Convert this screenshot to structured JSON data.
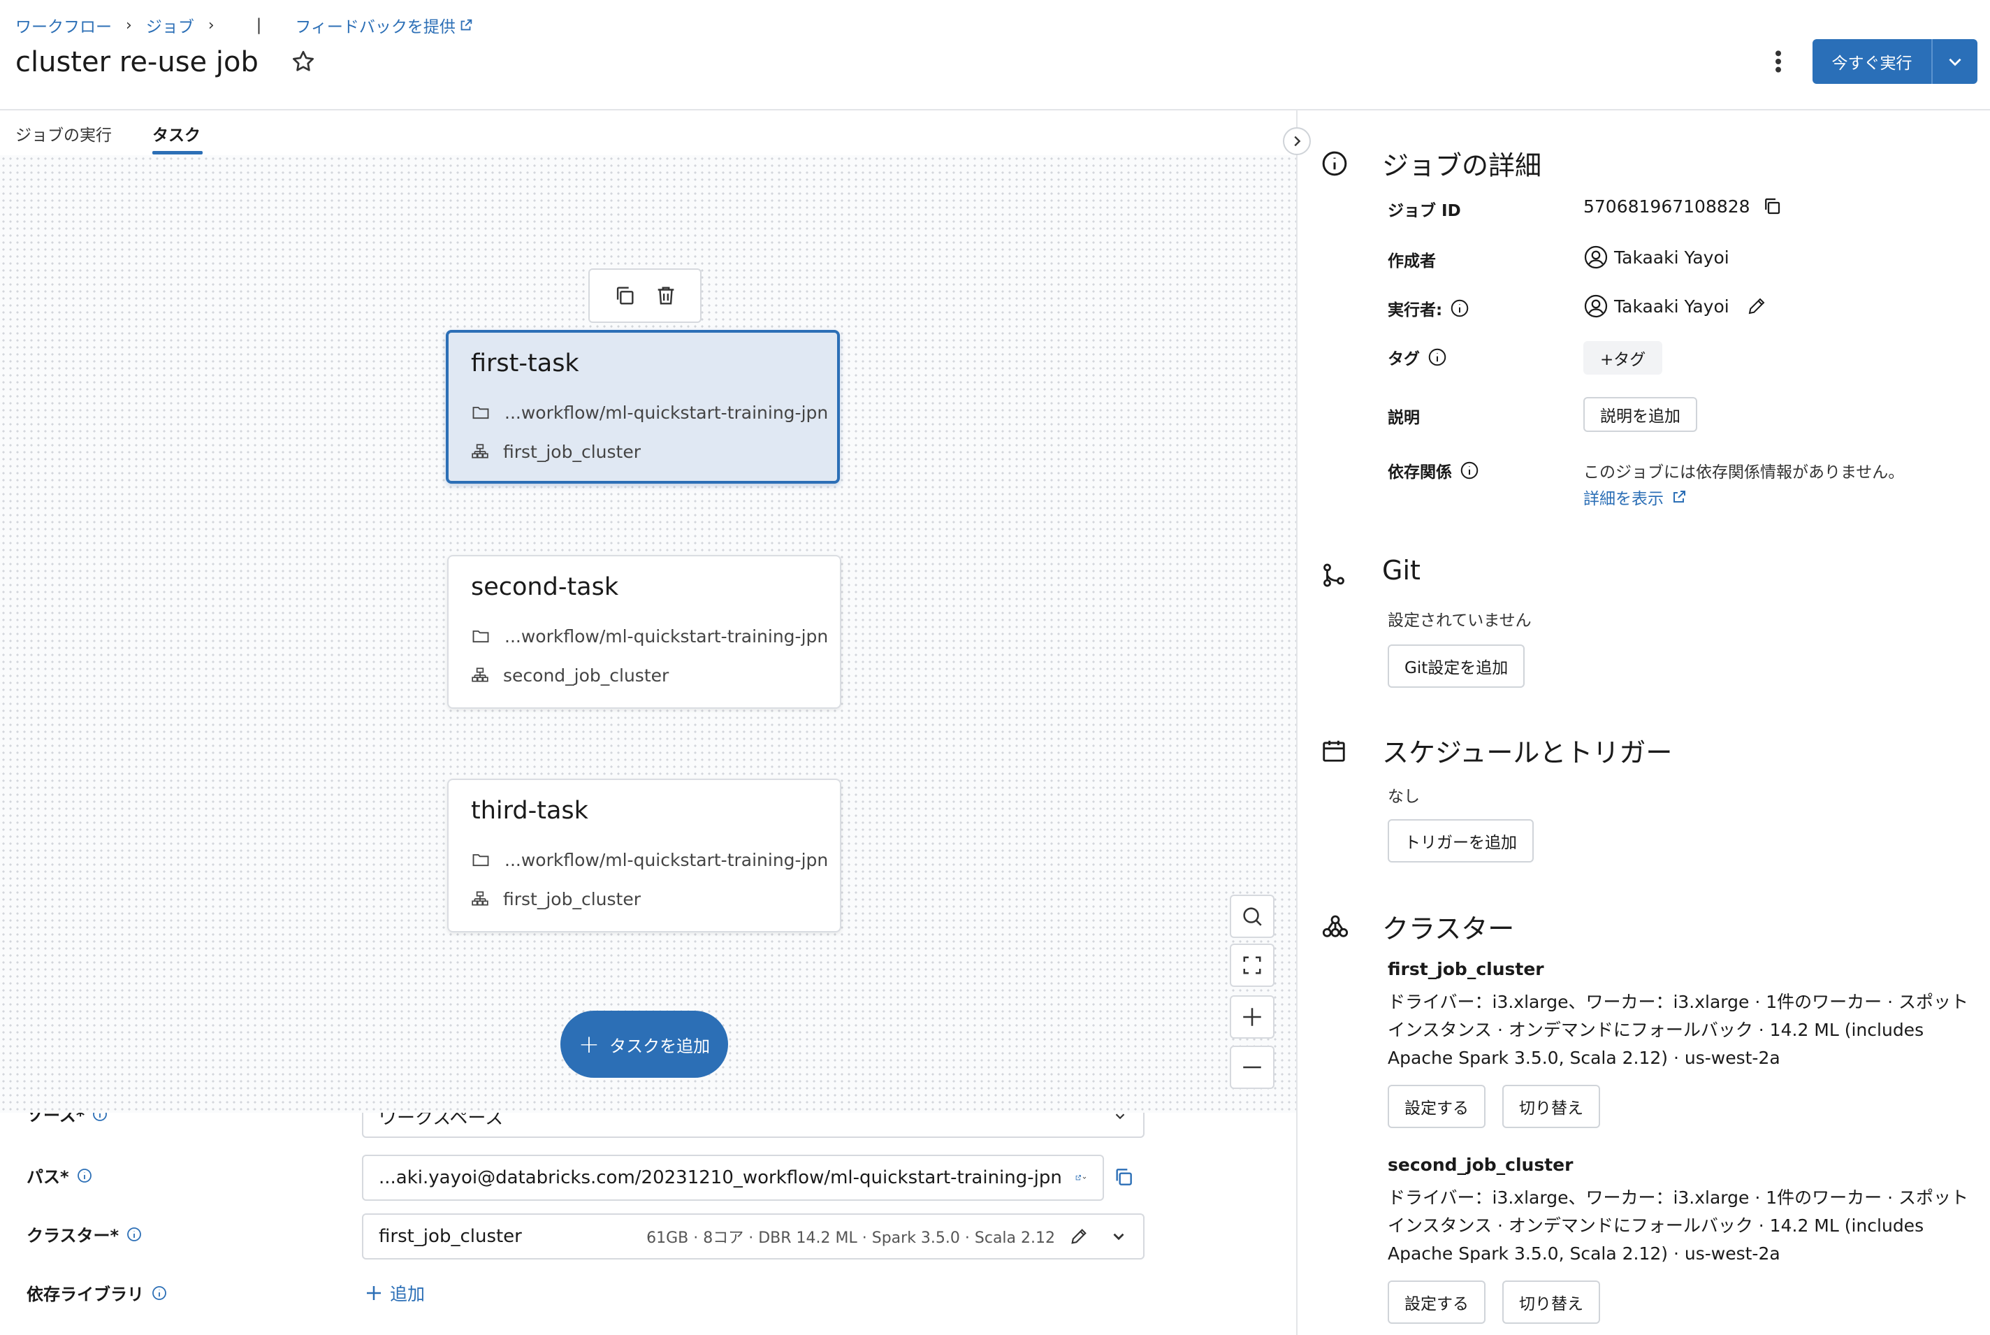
{
  "breadcrumb": {
    "workflows": "ワークフロー",
    "jobs": "ジョブ",
    "feedback": "フィードバックを提供"
  },
  "header": {
    "title": "cluster re-use job",
    "run_now": "今すぐ実行"
  },
  "tabs": {
    "runs": "ジョブの実行",
    "tasks": "タスク"
  },
  "tasks": [
    {
      "name": "first-task",
      "path": "...workflow/ml-quickstart-training-jpn",
      "cluster": "first_job_cluster",
      "selected": true
    },
    {
      "name": "second-task",
      "path": "...workflow/ml-quickstart-training-jpn",
      "cluster": "second_job_cluster",
      "selected": false
    },
    {
      "name": "third-task",
      "path": "...workflow/ml-quickstart-training-jpn",
      "cluster": "first_job_cluster",
      "selected": false
    }
  ],
  "canvas": {
    "add_task": "タスクを追加"
  },
  "form": {
    "source_label": "ソース*",
    "source_value": "ワークスペース",
    "path_label": "パス*",
    "path_value": "...aki.yayoi@databricks.com/20231210_workflow/ml-quickstart-training-jpn",
    "cluster_label": "クラスター*",
    "cluster_value": "first_job_cluster",
    "cluster_meta": "61GB · 8コア · DBR 14.2 ML · Spark 3.5.0 · Scala 2.12",
    "libraries_label": "依存ライブラリ",
    "add_library": "追加"
  },
  "details": {
    "title": "ジョブの詳細",
    "job_id_label": "ジョブ ID",
    "job_id": "570681967108828",
    "creator_label": "作成者",
    "creator": "Takaaki Yayoi",
    "run_as_label": "実行者:",
    "run_as": "Takaaki Yayoi",
    "tags_label": "タグ",
    "add_tag": "+タグ",
    "description_label": "説明",
    "add_description": "説明を追加",
    "dependencies_label": "依存関係",
    "dependencies_text": "このジョブには依存関係情報がありません。",
    "show_details": "詳細を表示"
  },
  "git": {
    "title": "Git",
    "status": "設定されていません",
    "add_button": "Git設定を追加"
  },
  "schedule": {
    "title": "スケジュールとトリガー",
    "status": "なし",
    "add_button": "トリガーを追加"
  },
  "clusters": {
    "title": "クラスター",
    "items": [
      {
        "name": "first_job_cluster",
        "desc": "ドライバー：i3.xlarge、ワーカー：i3.xlarge · 1件のワーカー · スポットインスタンス · オンデマンドにフォールバック · 14.2 ML (includes Apache Spark 3.5.0, Scala 2.12) · us-west-2a",
        "configure": "設定する",
        "swap": "切り替え"
      },
      {
        "name": "second_job_cluster",
        "desc": "ドライバー：i3.xlarge、ワーカー：i3.xlarge · 1件のワーカー · スポットインスタンス · オンデマンドにフォールバック · 14.2 ML (includes Apache Spark 3.5.0, Scala 2.12) · us-west-2a",
        "configure": "設定する",
        "swap": "切り替え"
      }
    ]
  },
  "colors": {
    "accent": "#2c6fb6",
    "selected_card_bg": "#e0e8f3"
  }
}
